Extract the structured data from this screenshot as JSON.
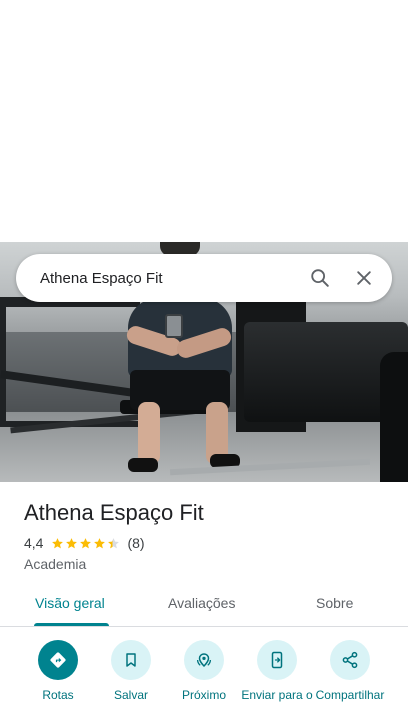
{
  "place": {
    "search_text": "Athena Espaço Fit",
    "name": "Athena Espaço Fit",
    "rating": "4,4",
    "rating_value": 4.4,
    "review_count": "(8)",
    "category": "Academia"
  },
  "tabs": [
    {
      "label": "Visão geral",
      "active": true
    },
    {
      "label": "Avaliações",
      "active": false
    },
    {
      "label": "Sobre",
      "active": false
    }
  ],
  "actions": [
    {
      "label": "Rotas",
      "icon": "directions-icon"
    },
    {
      "label": "Salvar",
      "icon": "bookmark-icon"
    },
    {
      "label": "Próximo",
      "icon": "nearby-icon"
    },
    {
      "label": "Enviar para o",
      "icon": "send-to-phone-icon"
    },
    {
      "label": "Compartilhar",
      "icon": "share-icon"
    }
  ],
  "colors": {
    "accent": "#00838f",
    "action_bg": "#d9f3f6",
    "star": "#fbbc04"
  }
}
